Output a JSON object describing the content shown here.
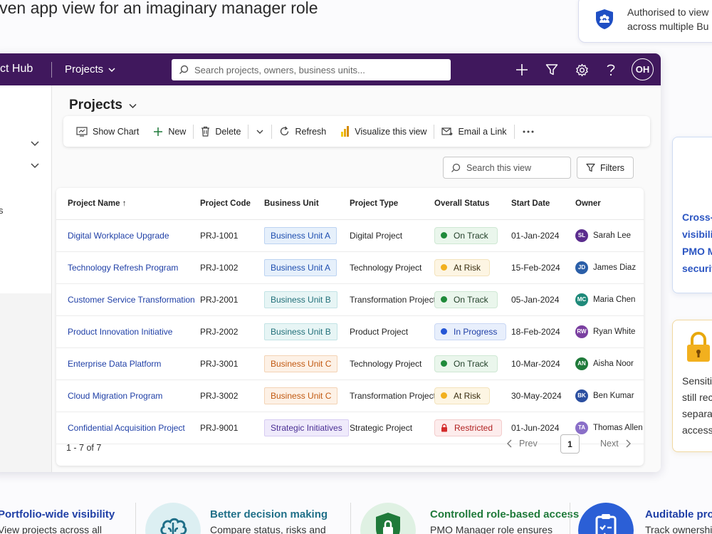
{
  "page_heading": "iven app view for an imaginary manager role",
  "auth_card": {
    "line1": "Authorised to view",
    "line2": "across multiple Bu"
  },
  "topbar": {
    "app_name": "ct Hub",
    "projects_menu": "Projects",
    "search_placeholder": "Search projects, owners, business units...",
    "avatar_initials": "OH"
  },
  "sidebar": {
    "fragment": "s"
  },
  "view": {
    "title": "Projects",
    "commands": {
      "show_chart": "Show Chart",
      "new": "New",
      "delete": "Delete",
      "refresh": "Refresh",
      "visualize": "Visualize this view",
      "email_link": "Email a Link"
    },
    "search_placeholder": "Search this view",
    "filters_label": "Filters"
  },
  "grid": {
    "columns": [
      "Project Name",
      "Project Code",
      "Business Unit",
      "Project Type",
      "Overall Status",
      "Start Date",
      "Owner"
    ],
    "rows": [
      {
        "name": "Digital Workplace Upgrade",
        "code": "PRJ-1001",
        "bu": "Business Unit A",
        "type": "Digital Project",
        "status": "On Track",
        "start": "01-Jan-2024",
        "owner": "Sarah Lee",
        "initials": "SL"
      },
      {
        "name": "Technology Refresh Program",
        "code": "PRJ-1002",
        "bu": "Business Unit A",
        "type": "Technology Project",
        "status": "At Risk",
        "start": "15-Feb-2024",
        "owner": "James Diaz",
        "initials": "JD"
      },
      {
        "name": "Customer Service Transformation",
        "code": "PRJ-2001",
        "bu": "Business Unit B",
        "type": "Transformation Project",
        "status": "On Track",
        "start": "05-Jan-2024",
        "owner": "Maria Chen",
        "initials": "MC"
      },
      {
        "name": "Product Innovation Initiative",
        "code": "PRJ-2002",
        "bu": "Business Unit B",
        "type": "Product Project",
        "status": "In Progress",
        "start": "18-Feb-2024",
        "owner": "Ryan White",
        "initials": "RW"
      },
      {
        "name": "Enterprise Data Platform",
        "code": "PRJ-3001",
        "bu": "Business Unit C",
        "type": "Technology Project",
        "status": "On Track",
        "start": "10-Mar-2024",
        "owner": "Aisha Noor",
        "initials": "AN"
      },
      {
        "name": "Cloud Migration Program",
        "code": "PRJ-3002",
        "bu": "Business Unit C",
        "type": "Transformation Project",
        "status": "At Risk",
        "start": "30-May-2024",
        "owner": "Ben Kumar",
        "initials": "BK"
      },
      {
        "name": "Confidential Acquisition Project",
        "code": "PRJ-9001",
        "bu": "Strategic Initiatives",
        "type": "Strategic Project",
        "status": "Restricted",
        "start": "01-Jun-2024",
        "owner": "Thomas Allen",
        "initials": "TA"
      }
    ],
    "record_count": "1 - 7 of 7",
    "prev_label": "Prev",
    "next_label": "Next",
    "page_number": "1"
  },
  "badge_colors": {
    "Business Unit A": {
      "bg": "#e6f0fb",
      "fg": "#1f4fb0",
      "border": "#bcd3f2"
    },
    "Business Unit B": {
      "bg": "#e7f5f5",
      "fg": "#22707a",
      "border": "#c2e3e5"
    },
    "Business Unit C": {
      "bg": "#fdf1e6",
      "fg": "#c25a12",
      "border": "#f3d3b5"
    },
    "Strategic Initiatives": {
      "bg": "#efeafb",
      "fg": "#4a2f94",
      "border": "#d6cbf2"
    }
  },
  "status_colors": {
    "On Track": {
      "bg": "#eaf6ec",
      "dot": "#1f8a3a",
      "fg": "#1f3d26",
      "border": "#cfe8d4"
    },
    "At Risk": {
      "bg": "#fdf5e3",
      "dot": "#f2b01e",
      "fg": "#3a2e10",
      "border": "#f3e3bc"
    },
    "In Progress": {
      "bg": "#e8effc",
      "dot": "#2456d6",
      "fg": "#1f3fa6",
      "border": "#c9d7f4"
    },
    "Restricted": {
      "bg": "#fdecec",
      "dot": "#d42b2b",
      "fg": "#b01f1f",
      "border": "#f3cccc"
    }
  },
  "owner_colors": [
    "#5b2d8e",
    "#2b5fa8",
    "#1f8a7a",
    "#7a3fa0",
    "#1f7a3a",
    "#2b4fa0",
    "#8a6fc8"
  ],
  "side_card_security": {
    "text": "Cross-\nvisibili\nPMO M\nsecurit"
  },
  "side_card_lock": {
    "text": "Sensiti\nstill rec\nsepara\naccess"
  },
  "features": [
    {
      "title": "Portfolio-wide visibility",
      "sub": "View projects across all",
      "color": "#1f3fa6"
    },
    {
      "title": "Better decision making",
      "sub": "Compare status, risks and",
      "color": "#1f6f88"
    },
    {
      "title": "Controlled role-based access",
      "sub": "PMO Manager role ensures",
      "color": "#1f7a3a"
    },
    {
      "title": "Auditable proje",
      "sub": "Track ownership",
      "color": "#1f3fa6"
    }
  ],
  "accent_purple": "#40185d"
}
